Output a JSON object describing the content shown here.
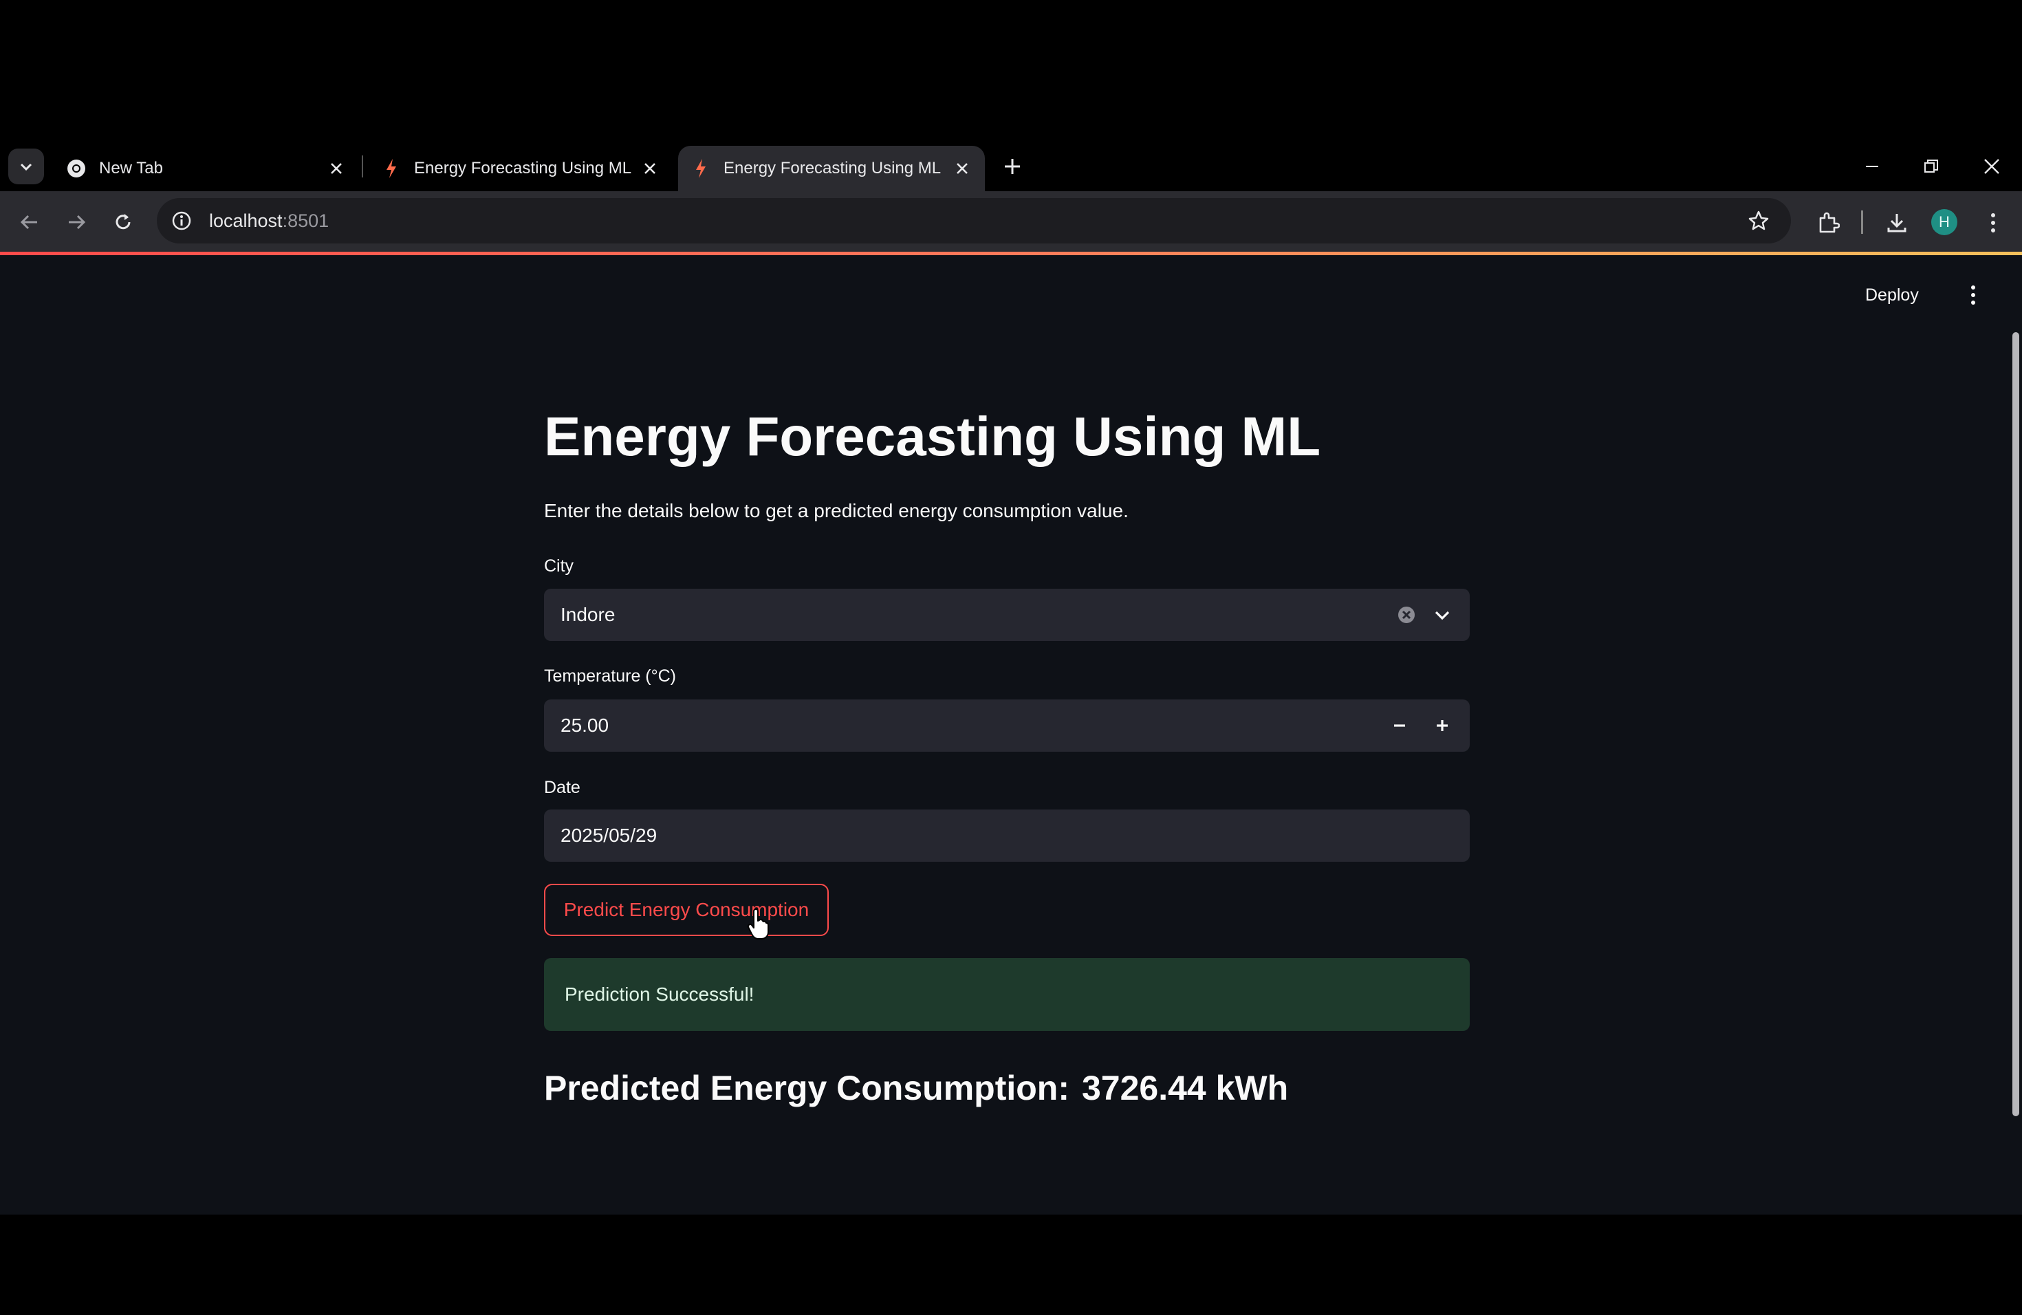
{
  "browser": {
    "tabs": [
      {
        "title": "New Tab",
        "icon": "chrome-icon",
        "active": false
      },
      {
        "title": "Energy Forecasting Using ML",
        "icon": "streamlit-bolt-icon",
        "active": false
      },
      {
        "title": "Energy Forecasting Using ML",
        "icon": "streamlit-bolt-icon",
        "active": true
      }
    ],
    "url_host": "localhost",
    "url_port": ":8501",
    "profile_initial": "H"
  },
  "app": {
    "deploy_label": "Deploy",
    "title": "Energy Forecasting Using ML",
    "description": "Enter the details below to get a predicted energy consumption value.",
    "city": {
      "label": "City",
      "value": "Indore"
    },
    "temperature": {
      "label": "Temperature (°C)",
      "value": "25.00"
    },
    "date": {
      "label": "Date",
      "value": "2025/05/29"
    },
    "predict_button": "Predict Energy Consumption",
    "success_message": "Prediction Successful!",
    "result_label": "Predicted Energy Consumption:",
    "result_value": "3726.44 kWh"
  },
  "colors": {
    "accent": "#ff4b4b",
    "page_bg": "#0e1117",
    "input_bg": "#262730",
    "success_bg": "#1e3a2c"
  }
}
